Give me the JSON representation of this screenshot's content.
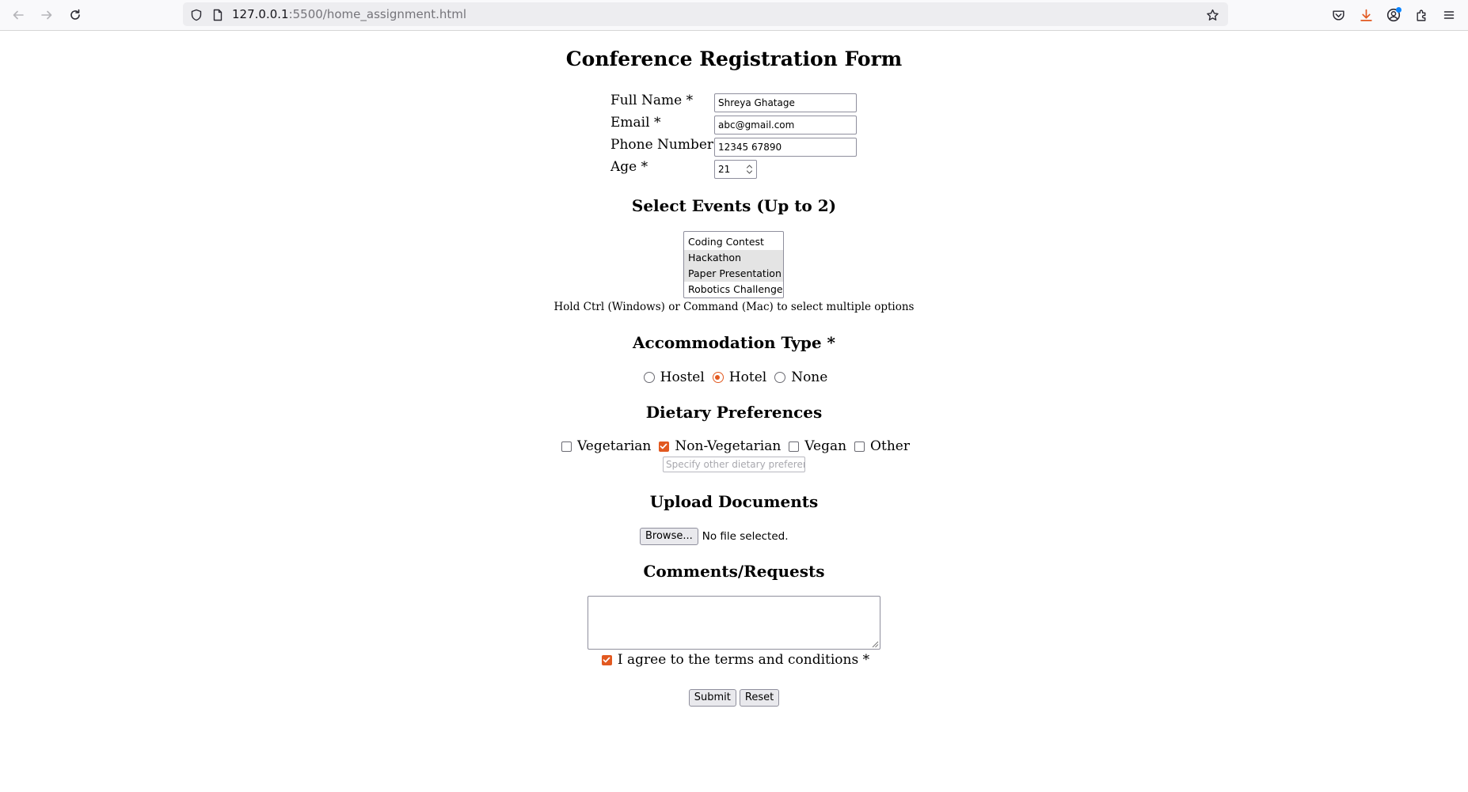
{
  "browser": {
    "url_host": "127.0.0.1",
    "url_rest": ":5500/home_assignment.html"
  },
  "form": {
    "title": "Conference Registration Form",
    "fields": [
      {
        "label": "Full Name *",
        "value": "Shreya Ghatage"
      },
      {
        "label": "Email *",
        "value": "abc@gmail.com"
      },
      {
        "label": "Phone Number *",
        "value": "12345 67890"
      },
      {
        "label": "Age *",
        "value": "21"
      }
    ],
    "events": {
      "heading": "Select Events (Up to 2)",
      "options": [
        "Coding Contest",
        "Hackathon",
        "Paper Presentation",
        "Robotics Challenge"
      ],
      "selected": [
        "Hackathon",
        "Paper Presentation"
      ],
      "hint": "Hold Ctrl (Windows) or Command (Mac) to select multiple options"
    },
    "accommodation": {
      "heading": "Accommodation Type *",
      "options": [
        "Hostel",
        "Hotel",
        "None"
      ],
      "selected": "Hotel"
    },
    "dietary": {
      "heading": "Dietary Preferences",
      "options": [
        "Vegetarian",
        "Non-Vegetarian",
        "Vegan",
        "Other"
      ],
      "checked": [
        "Non-Vegetarian"
      ],
      "other_placeholder": "Specify other dietary preferences"
    },
    "upload": {
      "heading": "Upload Documents",
      "button_label": "Browse...",
      "status": "No file selected."
    },
    "comments": {
      "heading": "Comments/Requests",
      "value": ""
    },
    "terms": {
      "label": "I agree to the terms and conditions *",
      "checked": true
    },
    "submit_label": "Submit",
    "reset_label": "Reset"
  },
  "colors": {
    "accent": "#e25920",
    "download_accent": "#e25920",
    "notification_dot": "#0a84ff"
  }
}
